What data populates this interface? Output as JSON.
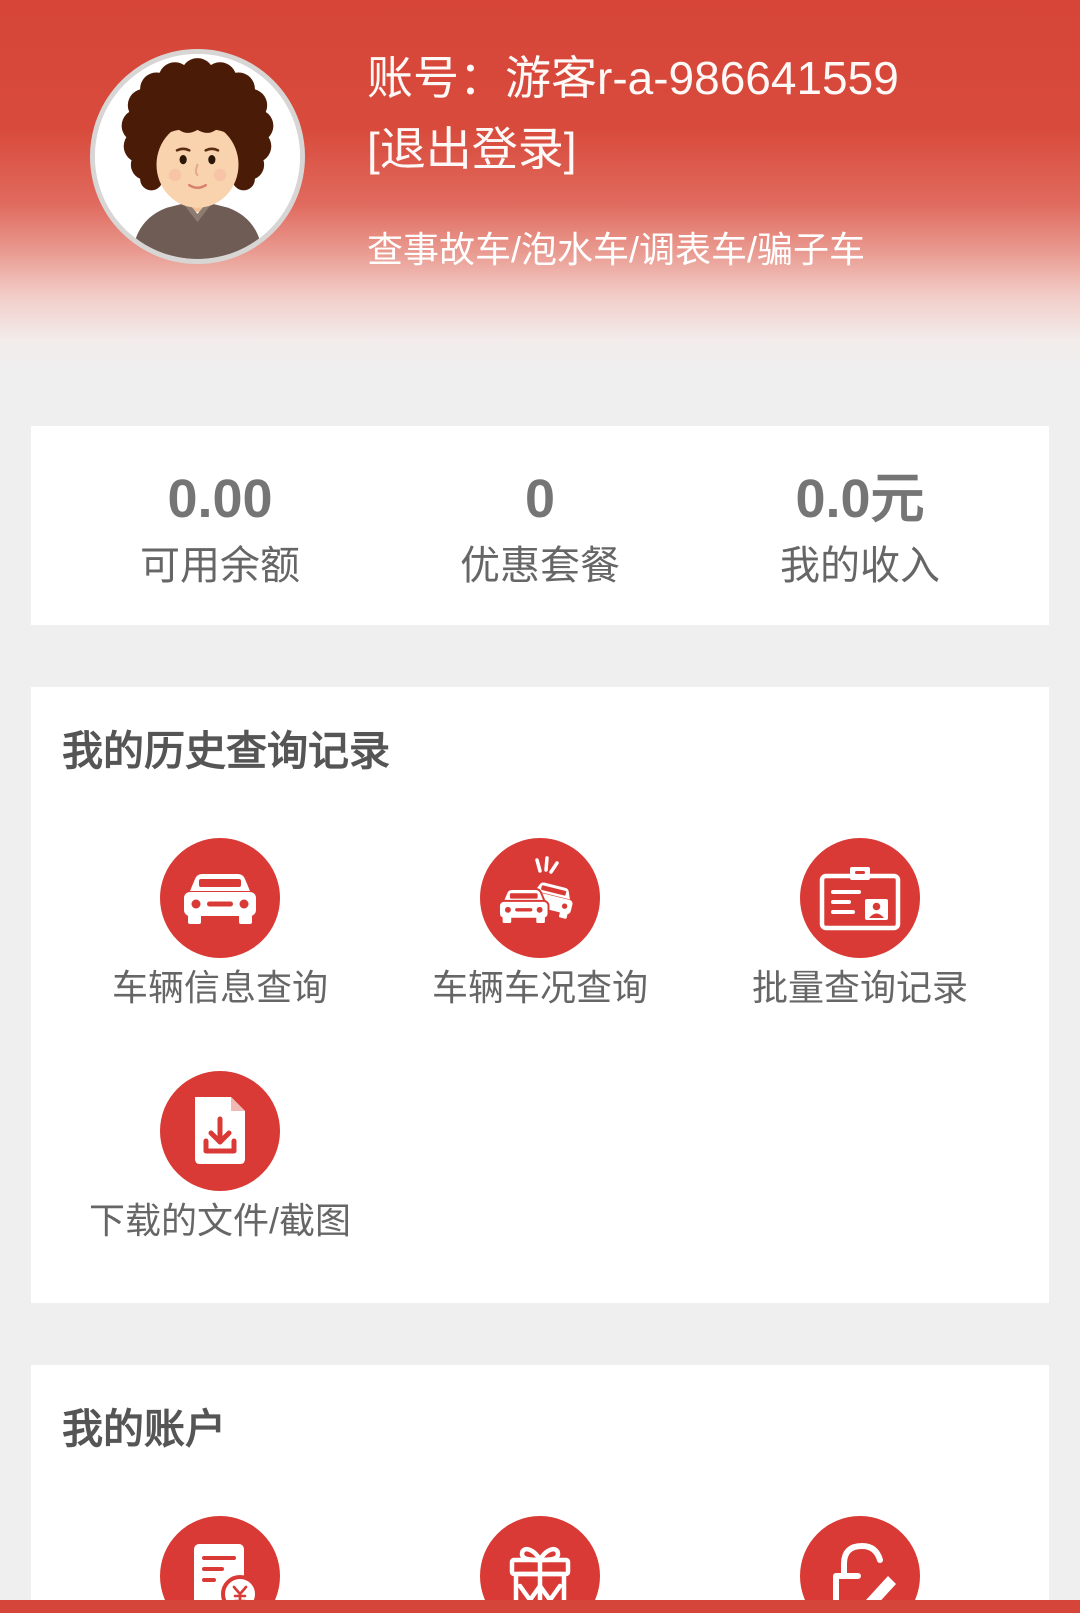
{
  "header": {
    "avatar_icon": "curly-hair-avatar-icon",
    "account_label": "账号：",
    "account_value": "游客r-a-986641559",
    "logout": "[退出登录]",
    "tagline": "查事故车/泡水车/调表车/骗子车"
  },
  "stats": [
    {
      "value": "0.00",
      "label": "可用余额"
    },
    {
      "value": "0",
      "label": "优惠套餐"
    },
    {
      "value": "0.0元",
      "label": "我的收入"
    }
  ],
  "history": {
    "title": "我的历史查询记录",
    "items": [
      {
        "label": "车辆信息查询",
        "icon": "car-icon"
      },
      {
        "label": "车辆车况查询",
        "icon": "car-crash-icon"
      },
      {
        "label": "批量查询记录",
        "icon": "id-badge-icon"
      },
      {
        "label": "下载的文件/截图",
        "icon": "file-download-icon"
      }
    ]
  },
  "account": {
    "title": "我的账户",
    "items": [
      {
        "icon": "bill-yuan-icon"
      },
      {
        "icon": "gift-icon"
      },
      {
        "icon": "lock-edit-icon"
      }
    ]
  },
  "colors": {
    "header_red": "#d64538",
    "icon_red": "#d93a35",
    "page_background": "#efefef",
    "bottom_bar": "#d6453a"
  }
}
